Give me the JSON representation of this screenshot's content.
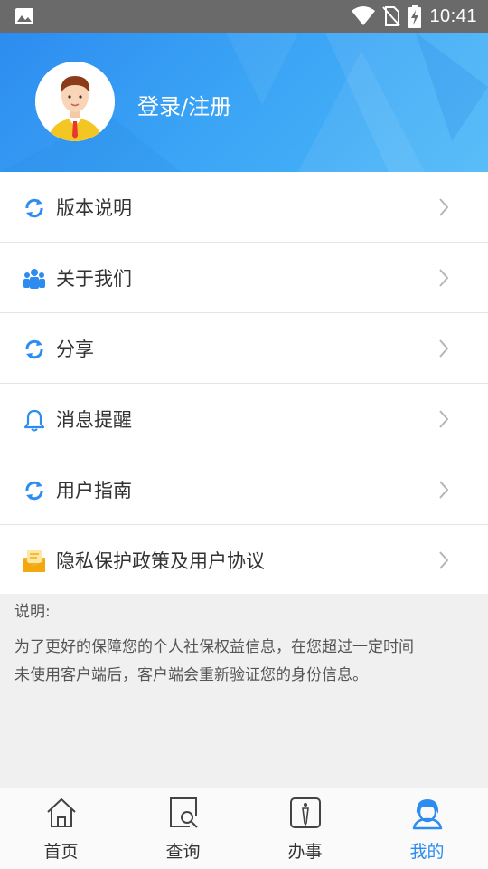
{
  "status_bar": {
    "time": "10:41"
  },
  "header": {
    "login_label": "登录/注册"
  },
  "menu": {
    "items": [
      {
        "label": "版本说明",
        "icon": "refresh-icon"
      },
      {
        "label": "关于我们",
        "icon": "people-icon"
      },
      {
        "label": "分享",
        "icon": "refresh-icon"
      },
      {
        "label": "消息提醒",
        "icon": "bell-icon"
      },
      {
        "label": "用户指南",
        "icon": "refresh-icon"
      },
      {
        "label": "隐私保护政策及用户协议",
        "icon": "envelope-icon"
      }
    ]
  },
  "notice": {
    "title": "说明:",
    "line1": "为了更好的保障您的个人社保权益信息，在您超过一定时间",
    "line2": "未使用客户端后，客户端会重新验证您的身份信息。"
  },
  "tabbar": {
    "tabs": [
      {
        "label": "首页",
        "icon": "home-icon"
      },
      {
        "label": "查询",
        "icon": "search-doc-icon"
      },
      {
        "label": "办事",
        "icon": "id-card-icon"
      },
      {
        "label": "我的",
        "icon": "user-icon",
        "active": true
      }
    ]
  },
  "colors": {
    "accent": "#2d8cf0",
    "header_start": "#2d8cf0",
    "header_end": "#4bb8f8",
    "icon_gold": "#f3b31b"
  }
}
